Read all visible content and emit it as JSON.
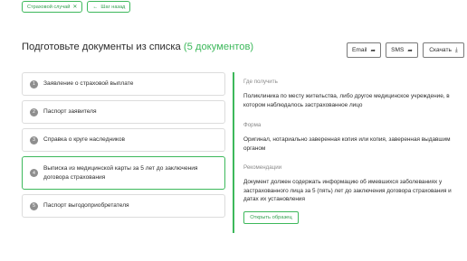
{
  "chips": {
    "insurance_case": "Страховой случай",
    "step_back": "Шаг назад"
  },
  "header": {
    "title": "Подготовьте документы из списка",
    "count": "(5 документов)"
  },
  "actions": {
    "email": "Email",
    "sms": "SMS",
    "download": "Скачать"
  },
  "documents": [
    {
      "num": "1",
      "label": "Заявление о страховой выплате"
    },
    {
      "num": "2",
      "label": "Паспорт заявителя"
    },
    {
      "num": "3",
      "label": "Справка о круге наследников"
    },
    {
      "num": "4",
      "label": "Выписка из медицинской карты за 5 лет до заключения договора страхования"
    },
    {
      "num": "5",
      "label": "Паспорт выгодоприобретателя"
    }
  ],
  "detail": {
    "where_title": "Где получить",
    "where_text": "Поликлиника по месту жительства, либо другое медицинское учреждение, в котором наблюдалось застрахованное лицо",
    "form_title": "Форма",
    "form_text": "Оригинал, нотариально заверенная копия или копия, заверенная выдавшим органом",
    "recs_title": "Рекомендации",
    "recs_text": "Документ должен содержать информацию об имевшихся заболеваниях у застрахованного лица за 5 (пять) лет до заключения договора страхования и датах их установления",
    "open_sample": "Открыть образец"
  },
  "icons": {
    "close": "close-icon",
    "back": "arrow-left-icon",
    "share": "share-icon",
    "download": "download-icon"
  },
  "colors": {
    "accent": "#3db85b",
    "text": "#2b2b2b",
    "muted": "#8a8a8a"
  }
}
